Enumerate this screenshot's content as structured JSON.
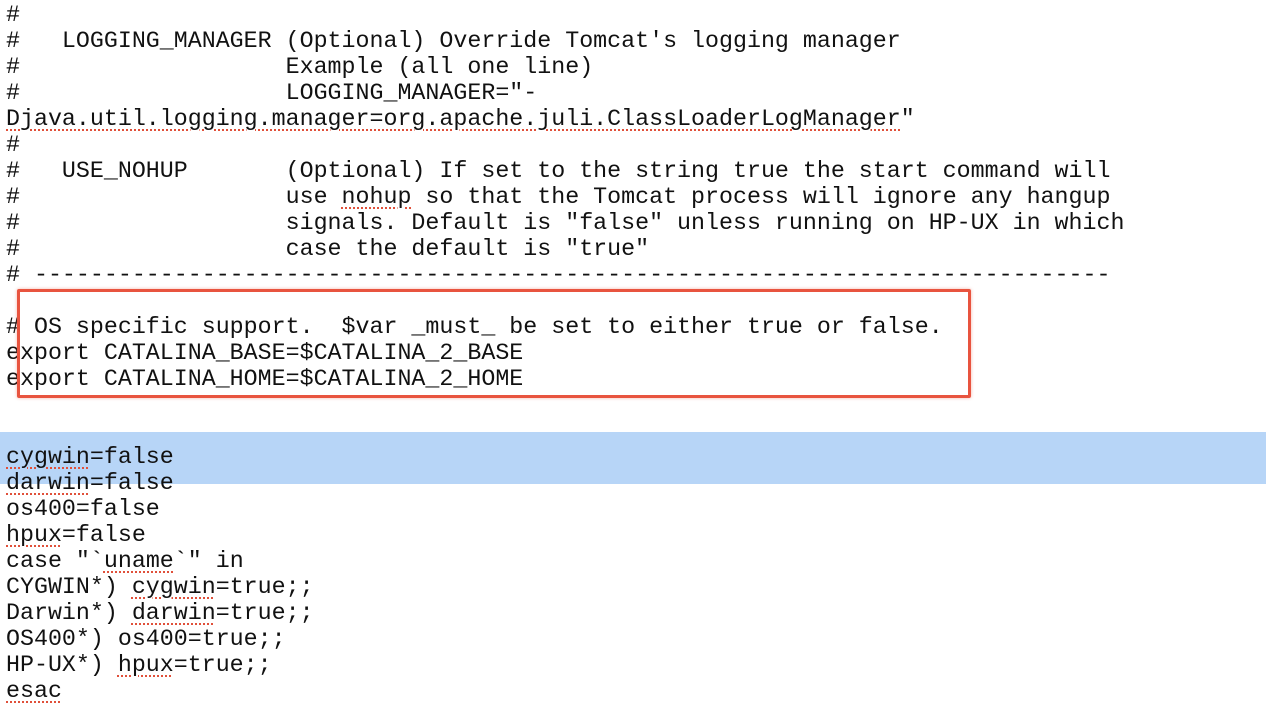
{
  "editor": {
    "highlight_color": "#e8543f",
    "selection_color": "#b7d5f7",
    "lines": [
      "#",
      "#   LOGGING_MANAGER (Optional) Override Tomcat's logging manager",
      "#                   Example (all one line)",
      "#                   LOGGING_MANAGER=\"-",
      "Djava.util.logging.manager=org.apache.juli.ClassLoaderLogManager\"",
      "#",
      "#   USE_NOHUP       (Optional) If set to the string true the start command will",
      "#                   use nohup so that the Tomcat process will ignore any hangup",
      "#                   signals. Default is \"false\" unless running on HP-UX in which",
      "#                   case the default is \"true\"",
      "# -----------------------------------------------------------------------------",
      "",
      "# OS specific support.  $var _must_ be set to either true or false.",
      "export CATALINA_BASE=$CATALINA_2_BASE",
      "export CATALINA_HOME=$CATALINA_2_HOME",
      "",
      "",
      "cygwin=false",
      "darwin=false",
      "os400=false",
      "hpux=false",
      "case \"`uname`\" in",
      "CYGWIN*) cygwin=true;;",
      "Darwin*) darwin=true;;",
      "OS400*) os400=true;;",
      "HP-UX*) hpux=true;;",
      "esac"
    ]
  }
}
